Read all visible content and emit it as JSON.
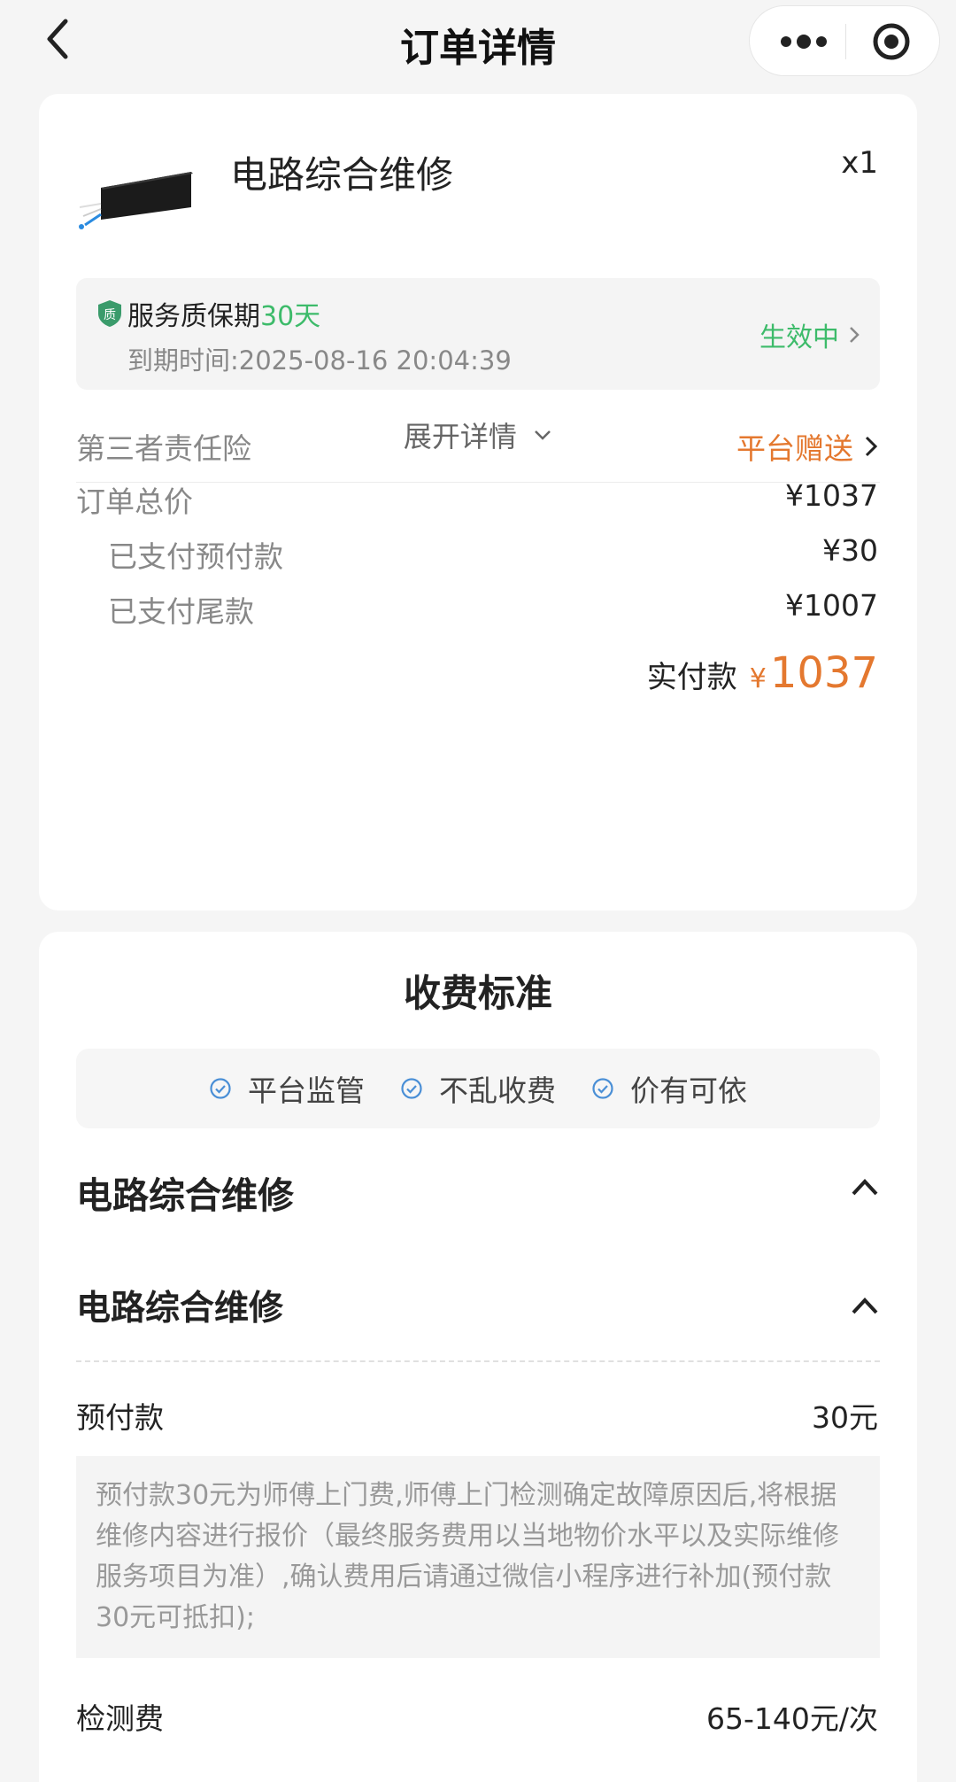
{
  "header": {
    "title": "订单详情"
  },
  "order": {
    "product_name": "电路综合维修",
    "quantity": "x1",
    "warranty": {
      "title_prefix": "服务质保期",
      "title_days": "30天",
      "expire": "到期时间:2025-08-16 20:04:39",
      "status": "生效中"
    },
    "expand_label": "展开详情",
    "rows": [
      {
        "label": "第三者责任险",
        "value": "平台赠送"
      },
      {
        "label": "订单总价",
        "value": "¥1037"
      },
      {
        "label": "已支付预付款",
        "value": "¥30"
      },
      {
        "label": "已支付尾款",
        "value": "¥1007"
      }
    ],
    "paid": {
      "label": "实付款",
      "currency": "¥",
      "amount": "1037"
    }
  },
  "standard": {
    "title": "收费标准",
    "badges": [
      "平台监管",
      "不乱收费",
      "价有可依"
    ],
    "category": "电路综合维修",
    "subcategory": "电路综合维修",
    "fees": [
      {
        "label": "预付款",
        "value": "30元"
      },
      {
        "label": "检测费",
        "value": "65-140元/次"
      }
    ],
    "prepay_note": "预付款30元为师傅上门费,师傅上门检测确定故障原因后,将根据维修内容进行报价（最终服务费用以当地物价水平以及实际维修服务项目为准）,确认费用后请通过微信小程序进行补加(预付款30元可抵扣);"
  },
  "colors": {
    "green": "#3dbb6a",
    "orange": "#e4782f",
    "check_blue": "#4a8fd6"
  }
}
